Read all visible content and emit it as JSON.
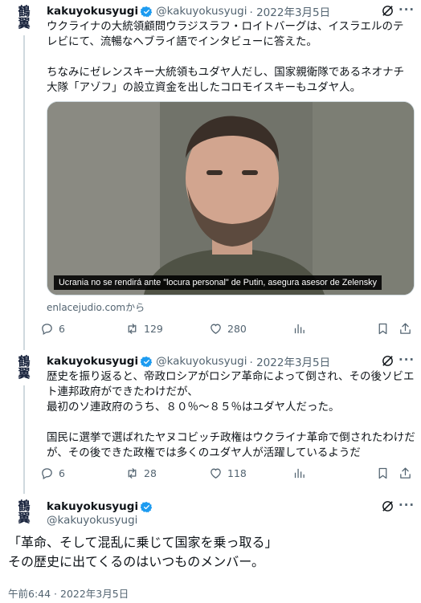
{
  "tweet1": {
    "name": "kakuyokusyugi",
    "handle": "@kakuyokusyugi",
    "date": "· 2022年3月5日",
    "text": "ウクライナの大統領顧問ウラジスラフ・ロイトバーグは、イスラエルのテレビにて、流暢なヘブライ語でインタビューに答えた。\n\nちなみにゼレンスキー大統領もユダヤ人だし、国家親衛隊であるネオナチ大隊「アゾフ」の設立資金を出したコロモイスキーもユダヤ人。",
    "video_caption": "Ucrania no se rendirá ante \"locura personal\" de Putin, asegura asesor de Zelensky",
    "source": "enlacejudio.comから",
    "replies": "6",
    "retweets": "129",
    "likes": "280"
  },
  "tweet2": {
    "name": "kakuyokusyugi",
    "handle": "@kakuyokusyugi",
    "date": "· 2022年3月5日",
    "text": "歴史を振り返ると、帝政ロシアがロシア革命によって倒され、その後ソビエト連邦政府ができたわけだが、\n最初のソ連政府のうち、８０％～８５％はユダヤ人だった。\n\n国民に選挙で選ばれたヤヌコビッチ政権はウクライナ革命で倒されたわけだが、その後できた政権では多くのユダヤ人が活躍しているようだ",
    "replies": "6",
    "retweets": "28",
    "likes": "118"
  },
  "tweet3": {
    "name": "kakuyokusyugi",
    "handle": "@kakuyokusyugi",
    "text": "「革命、そして混乱に乗じて国家を乗っ取る」\nその歴史に出てくるのはいつものメンバー。",
    "timestamp": "午前6:44 · 2022年3月5日"
  },
  "avatar_glyphs": [
    "鶴",
    "翼"
  ],
  "colors": {
    "accent": "#1d9bf0",
    "muted": "#536471",
    "text": "#0f1419"
  }
}
